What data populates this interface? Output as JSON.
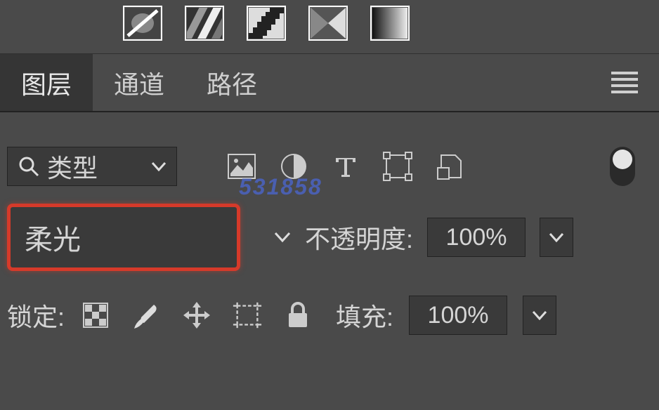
{
  "tabs": {
    "layers": "图层",
    "channels": "通道",
    "paths": "路径"
  },
  "filter": {
    "kind_label": "类型"
  },
  "blend": {
    "mode": "柔光",
    "opacity_label": "不透明度:",
    "opacity_value": "100%"
  },
  "lock": {
    "label": "锁定:",
    "fill_label": "填充:",
    "fill_value": "100%"
  },
  "watermark": "531858"
}
